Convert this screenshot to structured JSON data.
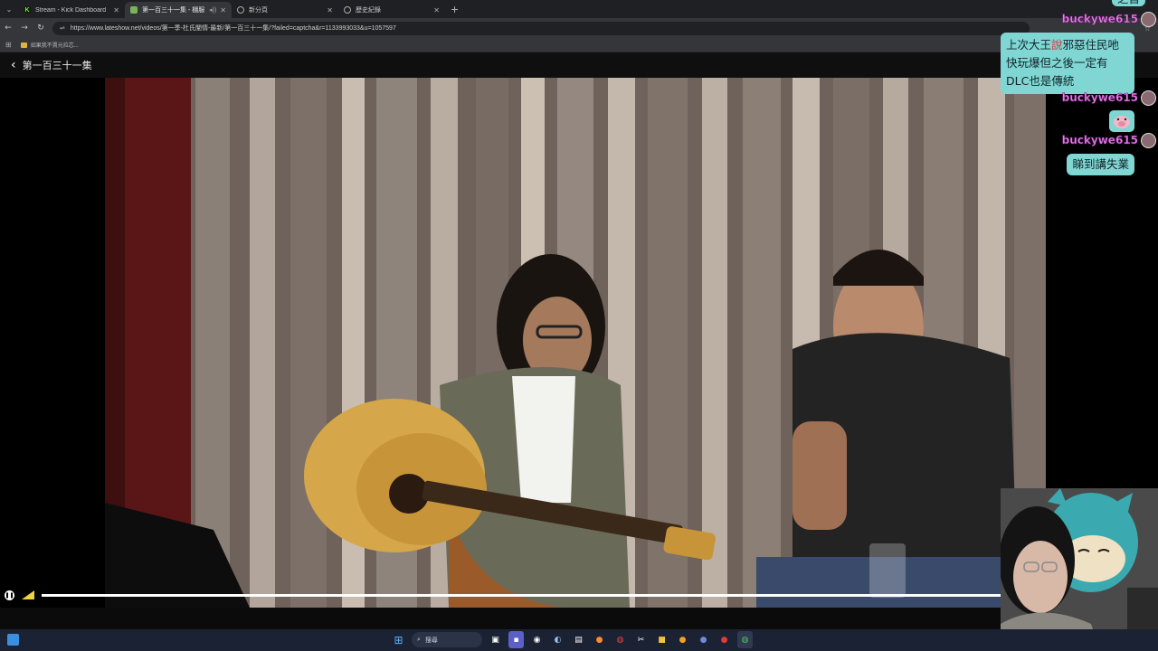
{
  "browser": {
    "tabs": [
      {
        "title": "Stream - Kick Dashboard",
        "favicon": "kick-icon",
        "color": "#53fc18",
        "active": false,
        "audio": false
      },
      {
        "title": "第一百三十一集 - 棚服",
        "favicon": "latesh-icon",
        "color": "#7ab35a",
        "active": true,
        "audio": true
      },
      {
        "title": "新分頁",
        "favicon": "chrome-icon",
        "color": "#aaaaaa",
        "active": false,
        "audio": false
      },
      {
        "title": "歷史紀錄",
        "favicon": "history-icon",
        "color": "#aaaaaa",
        "active": false,
        "audio": false
      }
    ],
    "url": "https://www.lateshow.net/videos/第一季-杜氏闡情-最新/第一百三十一集/?failed=captcha&r=1133993033&u=1057597",
    "bookmark": "如果我不賣元拉芯..."
  },
  "page": {
    "back_label": "‹",
    "title": "第一百三十一集"
  },
  "player": {
    "progress": 0.998
  },
  "chat": {
    "messages": [
      {
        "user": "buckywe615",
        "text_top": "之首"
      },
      {
        "user": "buckywe615",
        "lines": [
          "上次大王說邪惡住民吔",
          "快玩爆但之後一定有",
          "DLC也是傳統"
        ]
      },
      {
        "user": "buckywe615",
        "emote": "pig-emote"
      },
      {
        "user": "buckywe615",
        "text": "睇到講失業"
      }
    ]
  },
  "taskbar": {
    "search_label": "搜尋"
  },
  "colors": {
    "chat_name": "#e580e8",
    "bubble": "#7fd6d3",
    "taskbar": "#1b2233"
  }
}
